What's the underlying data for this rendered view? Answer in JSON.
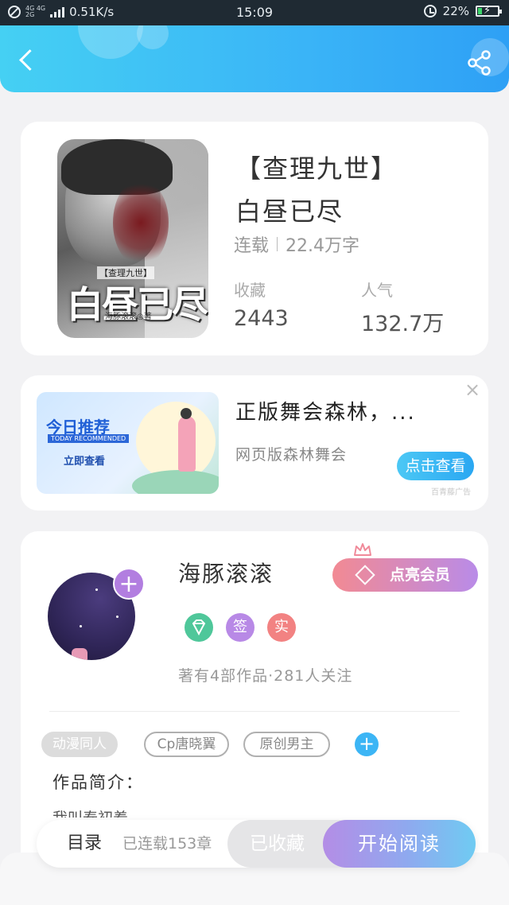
{
  "status_bar": {
    "net_speed": "0.51K/s",
    "net_type_top": "4G 4G",
    "net_type_bottom": "2G",
    "time": "15:09",
    "battery": "22%",
    "battery_level": 0.22
  },
  "header": {
    "back_icon": "chevron-left-icon",
    "share_icon": "share-icon"
  },
  "book": {
    "title_line1": "【查理九世】",
    "title_line2": "白昼已尽",
    "status": "连载",
    "word_count": "22.4万字",
    "favorites_label": "收藏",
    "favorites_value": "2443",
    "popularity_label": "人气",
    "popularity_value": "132.7万",
    "cover": {
      "subtitle": "【查理九世】",
      "title": "白昼已尽",
      "author": "海豚滚滚◎著"
    }
  },
  "ad": {
    "banner_title": "今日推荐",
    "banner_subtitle": "TODAY RECOMMENDED",
    "banner_cta": "立即查看",
    "title": "正版舞会森林，...",
    "description": "网页版森林舞会",
    "button_label": "点击查看",
    "source_tag": "百青藤广告",
    "close_symbol": "×"
  },
  "author": {
    "name": "海豚滚滚",
    "vip_button": "点亮会员",
    "badges": [
      {
        "label": "",
        "icon": "medal-icon",
        "color": "#4fc79a"
      },
      {
        "label": "签",
        "icon": "",
        "color": "#b889e6"
      },
      {
        "label": "实",
        "icon": "",
        "color": "#f28282"
      }
    ],
    "follow_info": "著有4部作品·281人关注",
    "tags": [
      "动漫同人",
      "Cp唐晓翼",
      "原创男主"
    ],
    "intro_label": "作品简介：",
    "intro_text": "我叫泰初着"
  },
  "bottom_bar": {
    "toc_label": "目录",
    "chapters_label": "已连载153章",
    "favorite_button": "已收藏",
    "read_button": "开始阅读"
  }
}
